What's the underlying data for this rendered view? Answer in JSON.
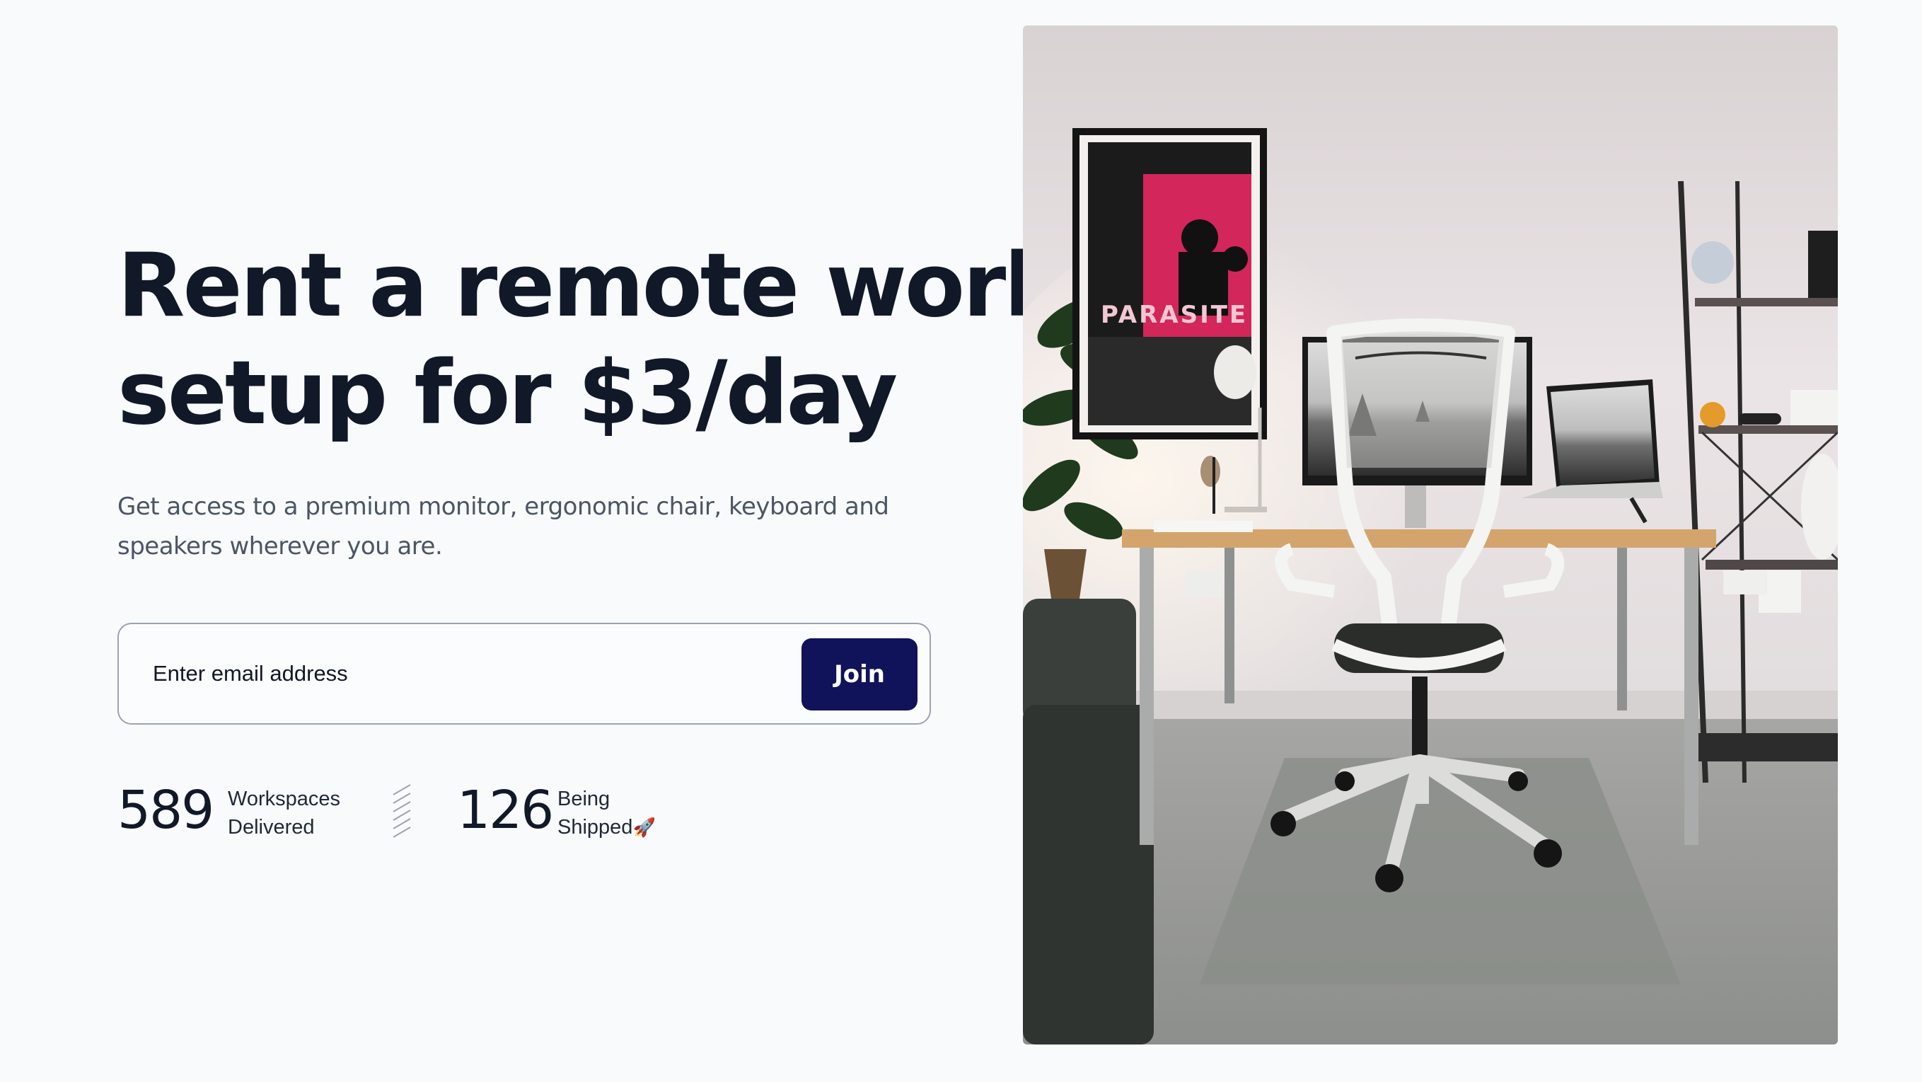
{
  "hero": {
    "headline_line1": "Rent a remote work",
    "headline_line2": "setup for $3/day",
    "sub_line1": "Get access to a premium monitor, ergonomic chair, keyboard and",
    "sub_line2": "speakers wherever you are."
  },
  "signup": {
    "placeholder": "Enter email address",
    "join_label": "Join"
  },
  "stats": {
    "delivered_count": "589",
    "delivered_label_1": "Workspaces",
    "delivered_label_2": "Delivered",
    "shipped_count": "126",
    "shipped_label_1": "Being",
    "shipped_label_2": "Shipped",
    "shipped_emoji": "🚀"
  },
  "poster": {
    "title": "PARASITE"
  },
  "colors": {
    "background": "#f8fafc",
    "headline": "#111827",
    "join_button": "#10125a"
  }
}
